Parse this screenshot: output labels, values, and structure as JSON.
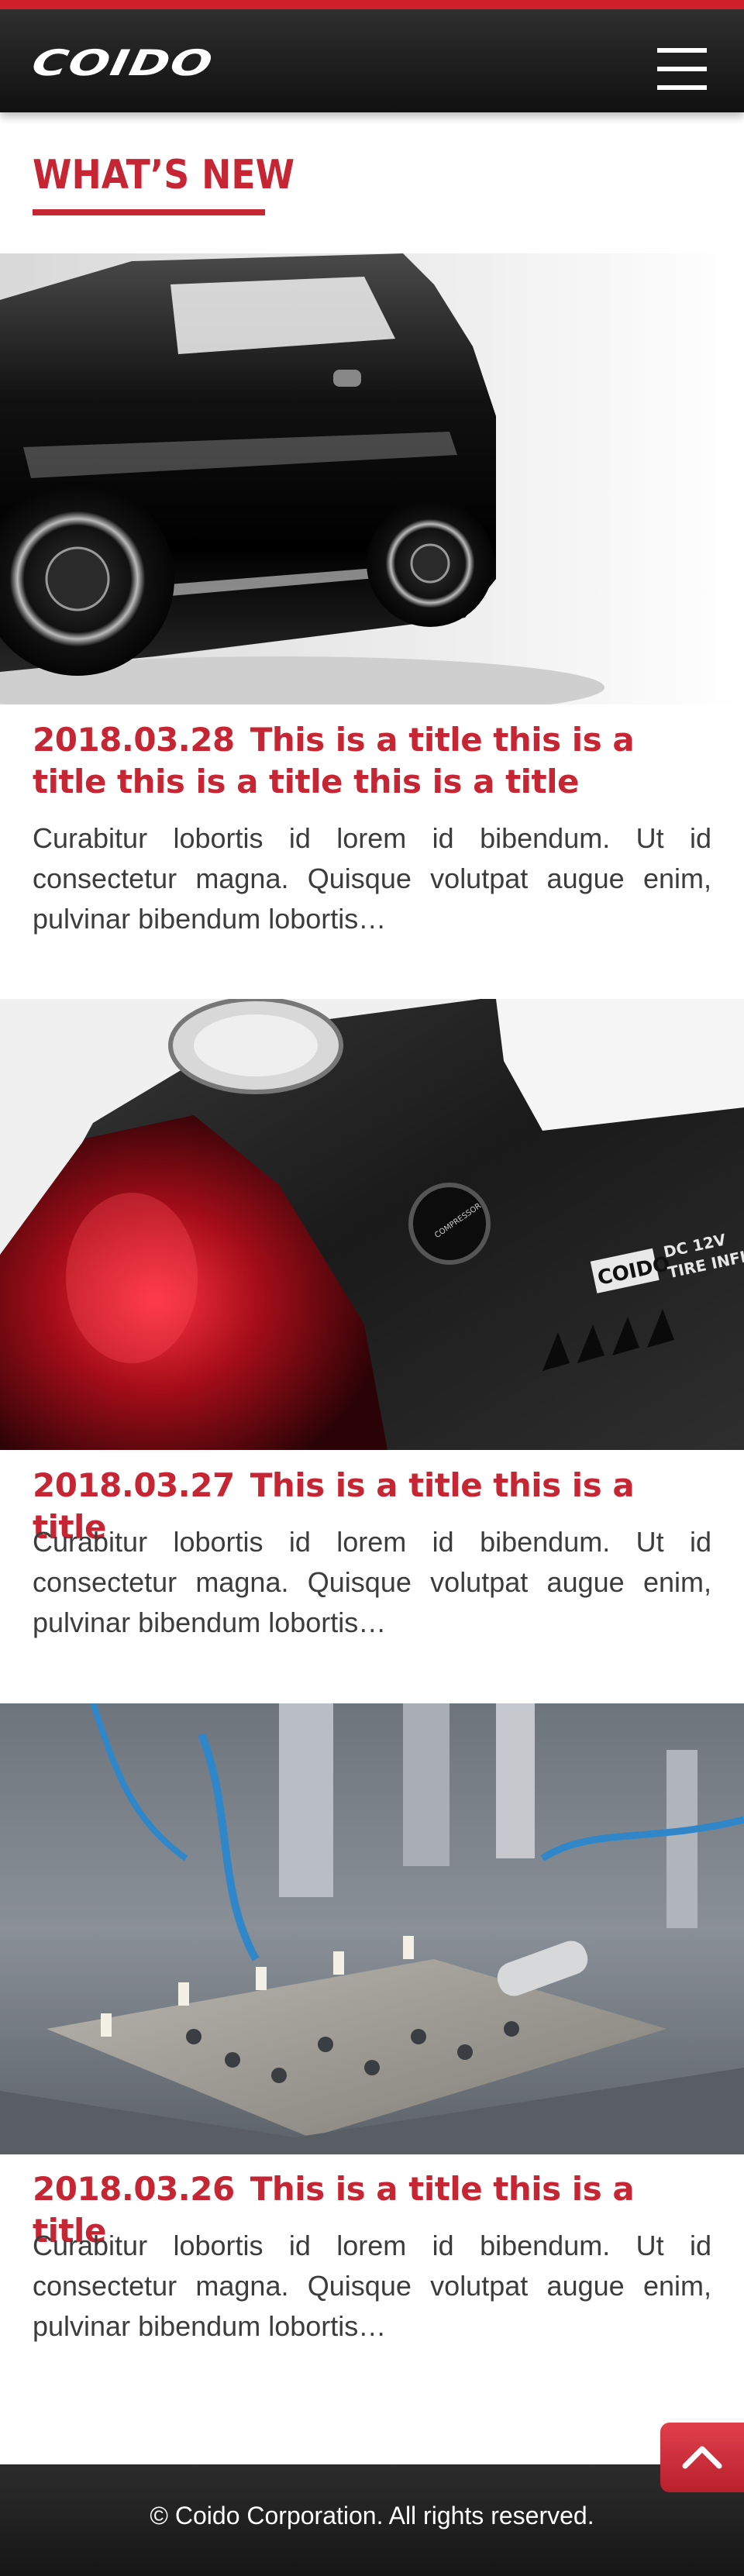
{
  "header": {
    "logo_text": "COIDO",
    "menu_icon": "hamburger-menu-icon"
  },
  "section": {
    "title": "WHAT’S NEW"
  },
  "news": [
    {
      "date": "2018.03.28",
      "title": "This is a title this is a title this is a title this is a title",
      "excerpt": "Curabitur lobortis id lorem id bibendum. Ut id consectetur magna. Quisque volutpat augue enim, pulvinar bibendum lobortis…"
    },
    {
      "date": "2018.03.27",
      "title": "This is a title this is a title",
      "excerpt": "Curabitur lobortis id lorem id bibendum. Ut id consectetur magna. Quisque volutpat augue enim, pulvinar bibendum lobortis…",
      "image_text": {
        "brand": "COIDO",
        "label_line1": "DC 12V",
        "label_line2": "TIRE INFLAT",
        "switch": "COMPRESSOR"
      }
    },
    {
      "date": "2018.03.26",
      "title": "This is a title this is a title",
      "excerpt": "Curabitur lobortis id lorem id bibendum. Ut id consectetur magna. Quisque volutpat augue enim, pulvinar bibendum lobortis…"
    }
  ],
  "footer": {
    "copyright": "© Coido Corporation. All rights reserved.",
    "back_to_top_icon": "chevron-up-icon"
  },
  "colors": {
    "brand_red": "#c62633",
    "header_dark": "#1c1c1c",
    "body_text": "#3c3c3c"
  }
}
